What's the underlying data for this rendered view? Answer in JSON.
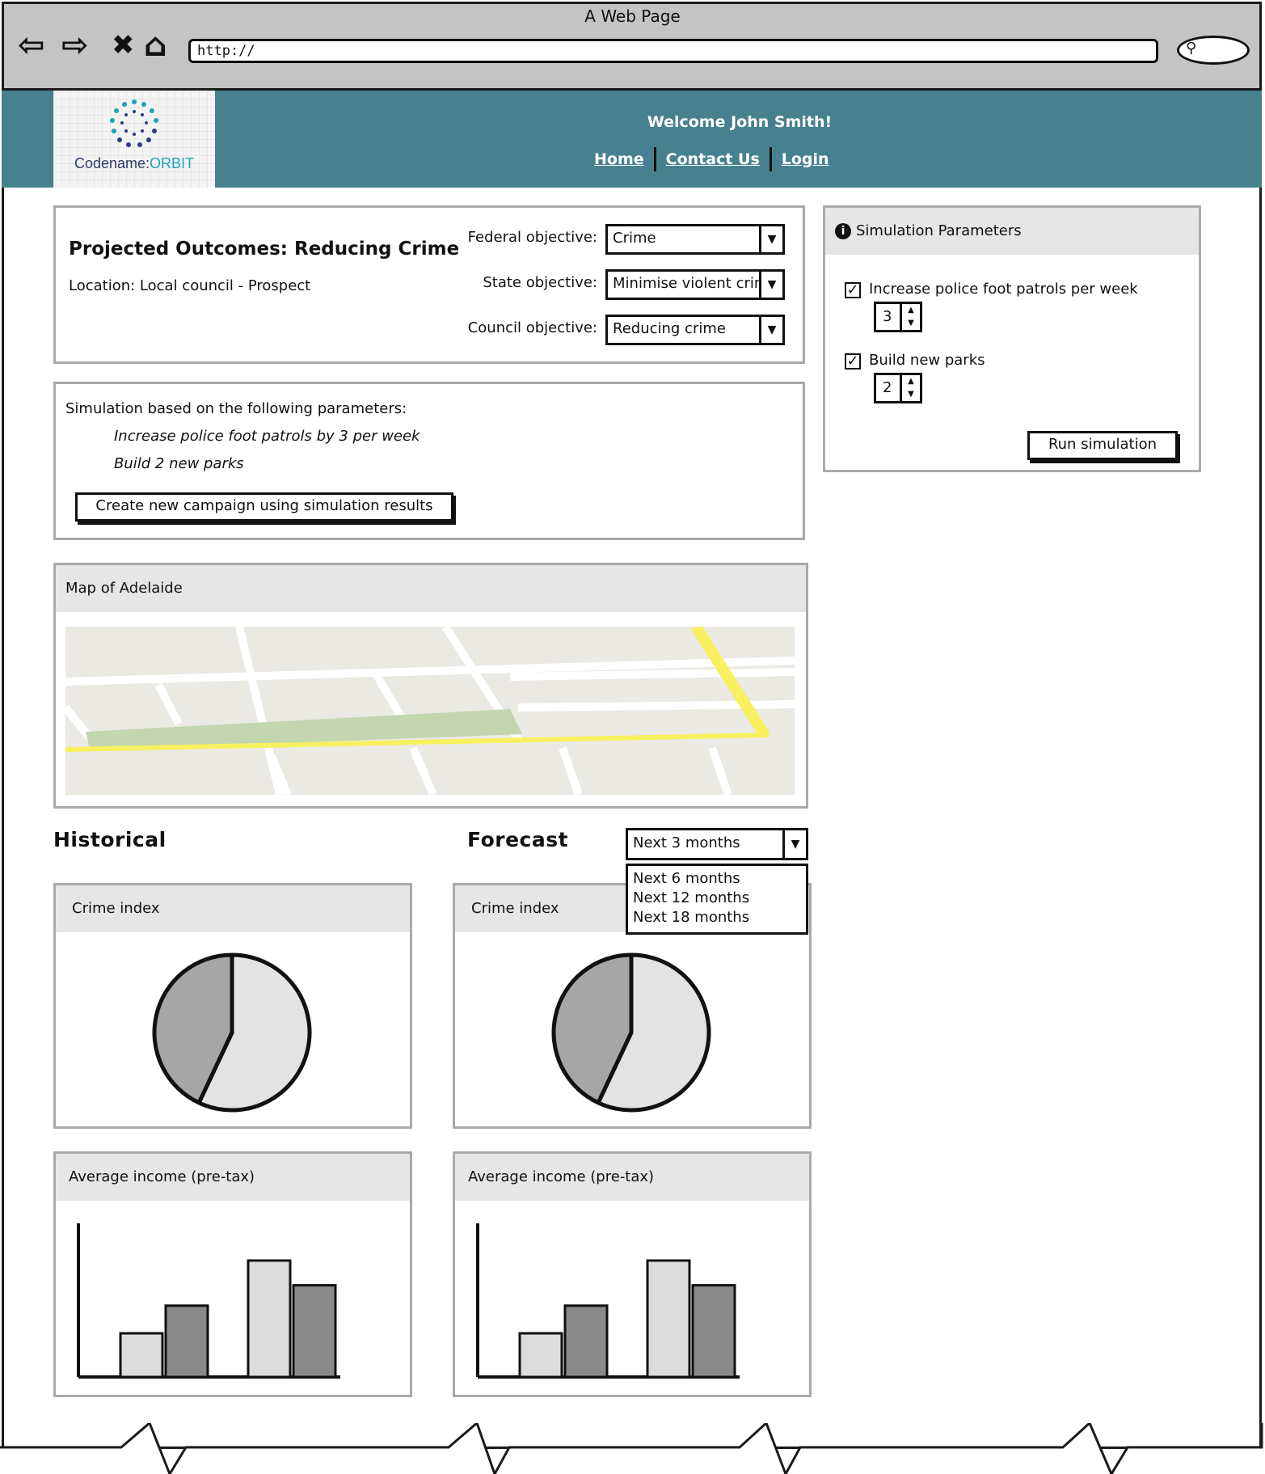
{
  "browser": {
    "window_title": "A Web Page",
    "url": "http://"
  },
  "header": {
    "logo_text_main": "Codename:",
    "logo_text_accent": "ORBIT",
    "welcome": "Welcome John Smith!",
    "nav": [
      {
        "label": "Home"
      },
      {
        "label": "Contact Us"
      },
      {
        "label": "Login"
      }
    ],
    "background_color": "#47818f"
  },
  "outcomes": {
    "title": "Projected Outcomes: Reducing Crime",
    "location": "Location: Local council - Prospect",
    "federal_label": "Federal objective:",
    "federal_value": "Crime",
    "state_label": "State objective:",
    "state_value": "Minimise violent crime",
    "council_label": "Council objective:",
    "council_value": "Reducing crime"
  },
  "simulation_summary": {
    "intro": "Simulation based on the following parameters:",
    "param1": "Increase police foot patrols by 3 per week",
    "param2": "Build 2 new parks",
    "create_button": "Create new campaign using simulation results"
  },
  "sim_params": {
    "title": "Simulation Parameters",
    "option1_label": "Increase police foot patrols per week",
    "option1_checked": true,
    "option1_value": "3",
    "option2_label": "Build new parks",
    "option2_checked": true,
    "option2_value": "2",
    "run_button": "Run simulation"
  },
  "map": {
    "title": "Map of Adelaide"
  },
  "historical": {
    "title": "Historical",
    "crime_title": "Crime index",
    "income_title": "Average income (pre-tax)"
  },
  "forecast": {
    "title": "Forecast",
    "range_selected": "Next 3 months",
    "range_options": [
      "Next 6 months",
      "Next 12 months",
      "Next 18 months"
    ],
    "crime_title": "Crime index",
    "income_title": "Average income (pre-tax)"
  },
  "chart_data": [
    {
      "type": "pie",
      "title": "Crime index",
      "slices": [
        {
          "value": 57,
          "color": "#e3e3e3"
        },
        {
          "value": 43,
          "color": "#a6a6a6"
        }
      ]
    },
    {
      "type": "bar",
      "title": "Average income (pre-tax)",
      "series": [
        {
          "values": [
            30,
            80
          ],
          "color": "#dcdcdc"
        },
        {
          "values": [
            49,
            63
          ],
          "color": "#8a8a8a"
        }
      ],
      "ylim": [
        0,
        100
      ]
    },
    {
      "type": "pie",
      "title": "Crime index",
      "slices": [
        {
          "value": 57,
          "color": "#e3e3e3"
        },
        {
          "value": 43,
          "color": "#a6a6a6"
        }
      ]
    },
    {
      "type": "bar",
      "title": "Average income (pre-tax)",
      "series": [
        {
          "values": [
            30,
            80
          ],
          "color": "#dcdcdc"
        },
        {
          "values": [
            49,
            63
          ],
          "color": "#8a8a8a"
        }
      ],
      "ylim": [
        0,
        100
      ]
    }
  ]
}
